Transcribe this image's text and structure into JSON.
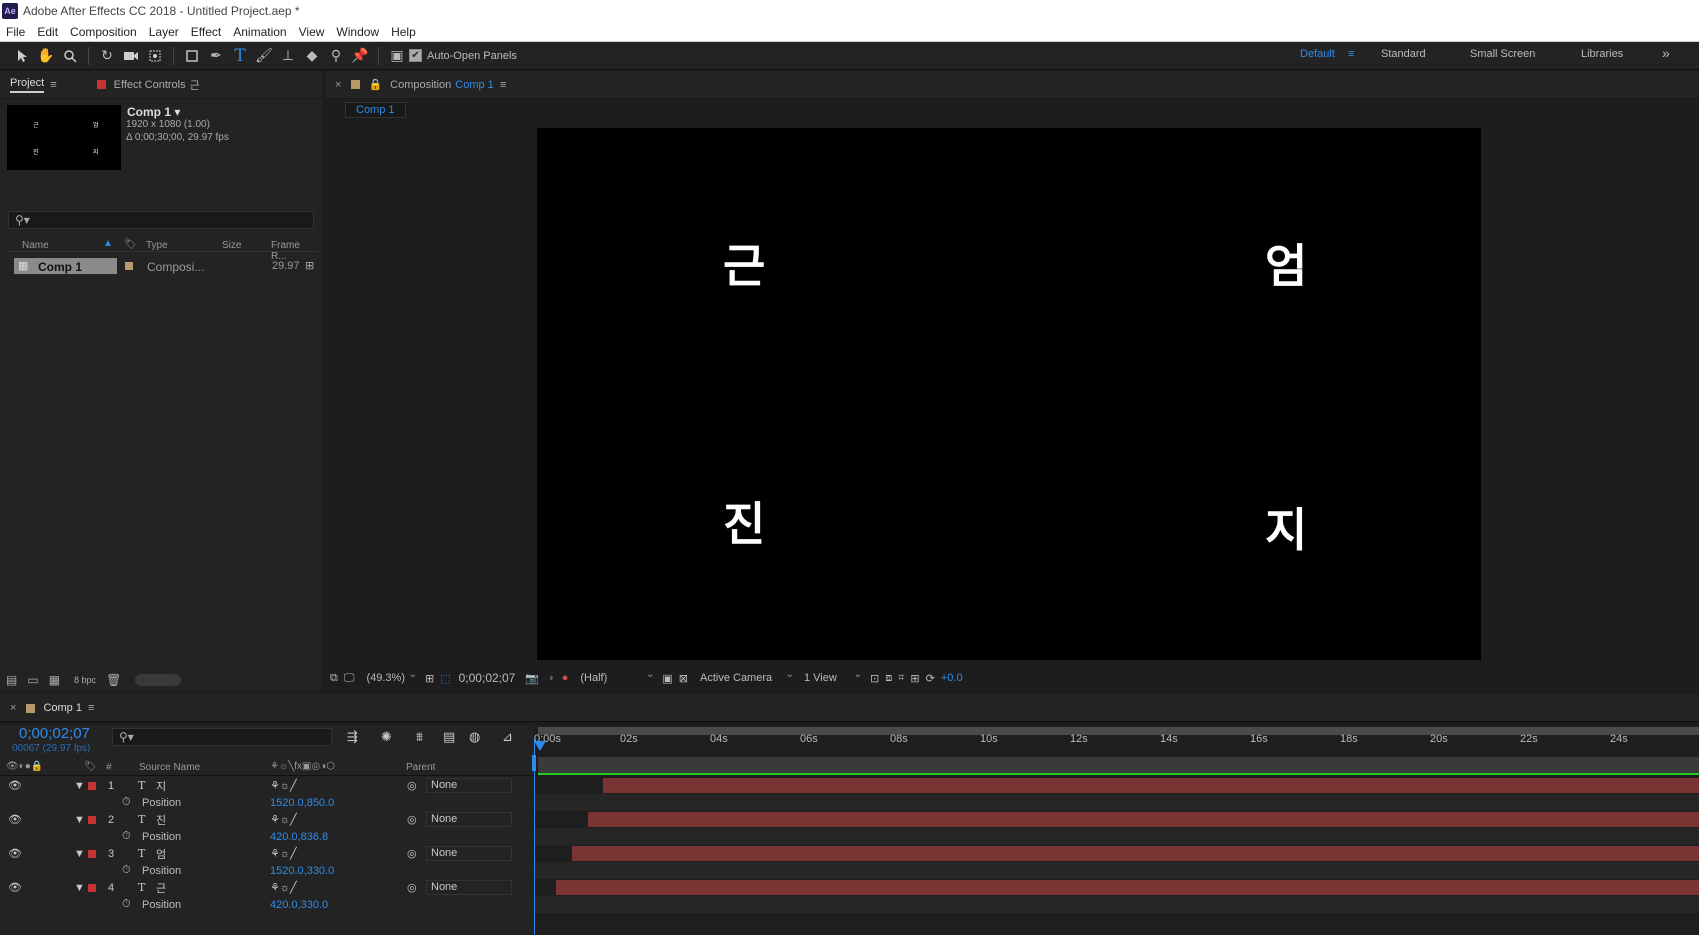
{
  "window": {
    "app_icon": "Ae",
    "title": "Adobe After Effects CC 2018 - Untitled Project.aep *"
  },
  "menu": [
    "File",
    "Edit",
    "Composition",
    "Layer",
    "Effect",
    "Animation",
    "View",
    "Window",
    "Help"
  ],
  "toolbar": {
    "auto_open_label": "Auto-Open Panels",
    "workspaces": [
      "Default",
      "Standard",
      "Small Screen",
      "Libraries"
    ],
    "more": "»"
  },
  "project_panel": {
    "tabs": {
      "project": "Project",
      "effect_controls": "Effect Controls",
      "effect_controls_target": "근"
    },
    "comp_name": "Comp 1",
    "comp_size": "1920 x 1080 (1.00)",
    "comp_duration": "Δ 0;00;30;00, 29.97 fps",
    "thumb_glyphs": [
      "근",
      "엄",
      "진",
      "지"
    ],
    "columns": {
      "name": "Name",
      "type": "Type",
      "size": "Size",
      "frame_rate": "Frame R..."
    },
    "items": [
      {
        "name": "Comp 1",
        "type": "Composi...",
        "frame_rate": "29.97"
      }
    ],
    "bpc": "8 bpc"
  },
  "comp_panel": {
    "tab_prefix": "Composition",
    "tab_name": "Comp 1",
    "breadcrumb": "Comp 1",
    "glyphs": {
      "top_left": "근",
      "top_right": "엄",
      "bottom_left": "진",
      "bottom_right": "지"
    },
    "zoom": "(49.3%)",
    "timecode": "0;00;02;07",
    "resolution": "(Half)",
    "camera": "Active Camera",
    "views": "1 View",
    "exposure": "+0.0"
  },
  "timeline": {
    "tab": "Comp 1",
    "current_time": "0;00;02;07",
    "frame_info": "00067 (29.97 fps)",
    "columns": {
      "number": "#",
      "source_name": "Source Name",
      "parent": "Parent"
    },
    "ruler": [
      "0:00s",
      "02s",
      "04s",
      "06s",
      "08s",
      "10s",
      "12s",
      "14s",
      "16s",
      "18s",
      "20s",
      "22s",
      "24s"
    ],
    "layers": [
      {
        "num": "1",
        "name": "지",
        "prop": "Position",
        "value": "1520.0,850.0",
        "parent": "None"
      },
      {
        "num": "2",
        "name": "진",
        "prop": "Position",
        "value": "420.0,836.8",
        "parent": "None"
      },
      {
        "num": "3",
        "name": "엄",
        "prop": "Position",
        "value": "1520.0,330.0",
        "parent": "None"
      },
      {
        "num": "4",
        "name": "근",
        "prop": "Position",
        "value": "420.0,330.0",
        "parent": "None"
      }
    ],
    "layer_start_seconds": [
      1.45,
      1.1,
      0.75,
      0.4
    ]
  },
  "colors": {
    "accent": "#2d8ceb",
    "layer_label": "#c83232",
    "layer_bar": "#7a3434",
    "work_area": "#22cc22",
    "comp_label": "#b89a6a"
  }
}
